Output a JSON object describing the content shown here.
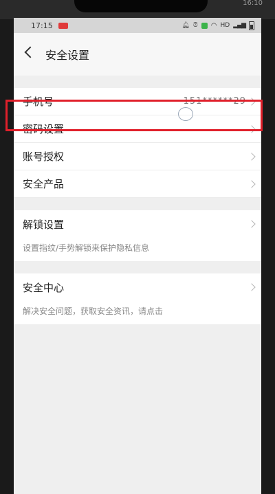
{
  "status_bar": {
    "time": "17:15",
    "hw_time": "16:10",
    "network": "HD"
  },
  "header": {
    "title": "安全设置"
  },
  "groups": {
    "account": {
      "phone": {
        "label": "手机号",
        "value": "151******29"
      },
      "password": {
        "label": "密码设置"
      },
      "auth": {
        "label": "账号授权"
      },
      "products": {
        "label": "安全产品"
      }
    },
    "unlock": {
      "label": "解锁设置",
      "hint": "设置指纹/手势解锁来保护隐私信息"
    },
    "center": {
      "label": "安全中心",
      "hint": "解决安全问题，获取安全资讯，请点击"
    }
  },
  "icons": {
    "back": "chevron-left-icon",
    "chevron": "chevron-right-icon"
  },
  "colors": {
    "highlight": "#e1202b",
    "background": "#efefef",
    "row": "#ffffff"
  }
}
